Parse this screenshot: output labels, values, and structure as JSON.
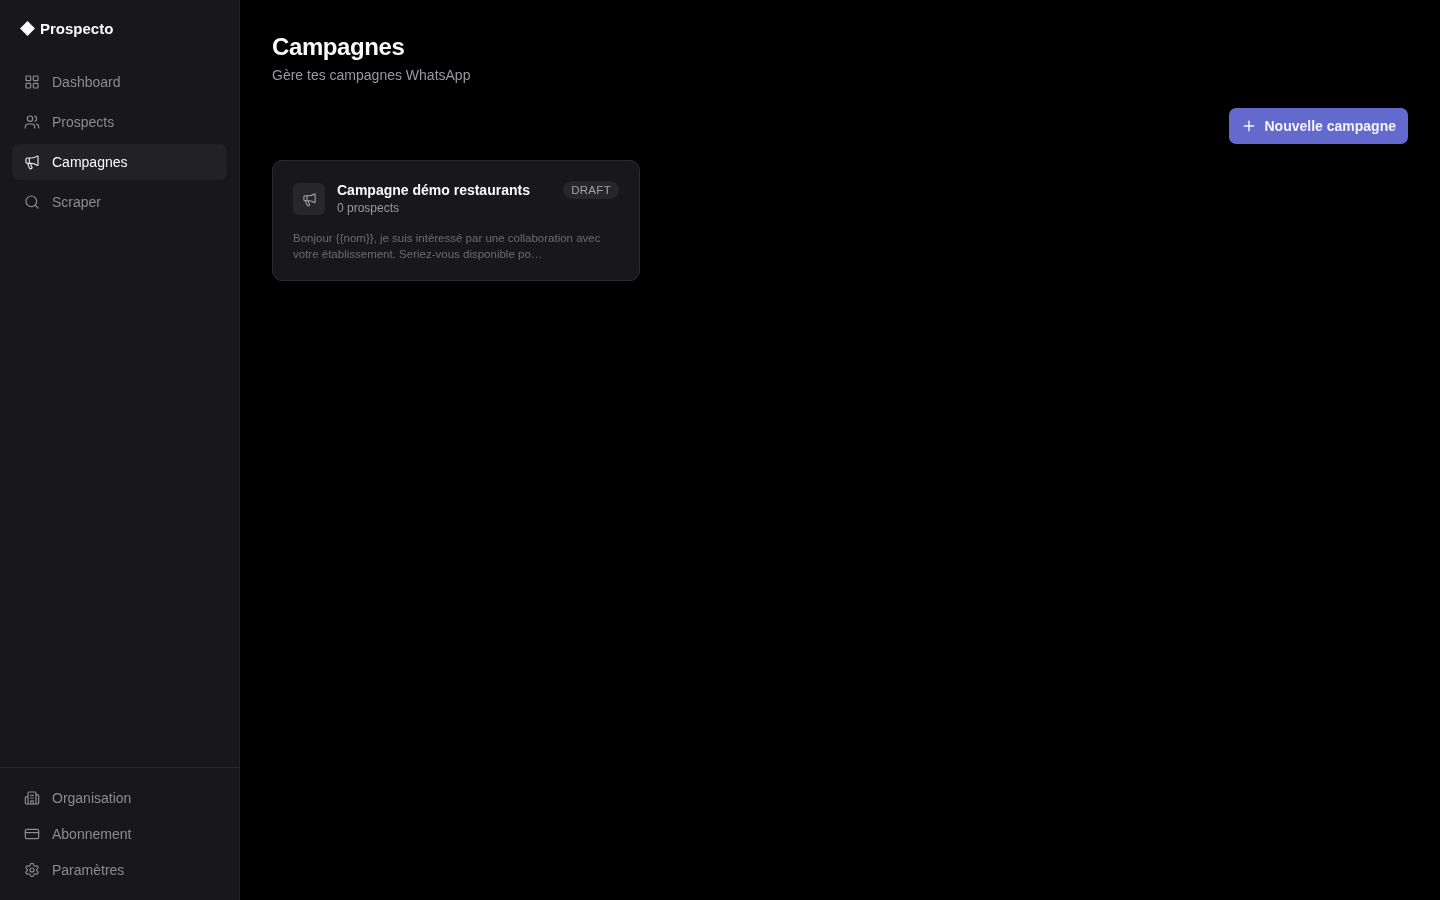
{
  "brand": {
    "name": "Prospecto"
  },
  "sidebar": {
    "items": [
      {
        "label": "Dashboard",
        "selected": false
      },
      {
        "label": "Prospects",
        "selected": false
      },
      {
        "label": "Campagnes",
        "selected": true
      },
      {
        "label": "Scraper",
        "selected": false
      }
    ],
    "footer_items": [
      {
        "label": "Organisation",
        "selected": false
      },
      {
        "label": "Abonnement",
        "selected": false
      },
      {
        "label": "Paramètres",
        "selected": false
      }
    ]
  },
  "header": {
    "title": "Campagnes",
    "subtitle": "Gère tes campagnes WhatsApp"
  },
  "new_button": {
    "label": "Nouvelle campagne"
  },
  "campaigns": [
    {
      "name": "Campagne démo restaurants",
      "prospects": "0 prospects",
      "status": "DRAFT",
      "message": "Bonjour {{nom}}, je suis intéressé par une collaboration avec votre établissement. Seriez-vous disponible po…"
    }
  ]
}
